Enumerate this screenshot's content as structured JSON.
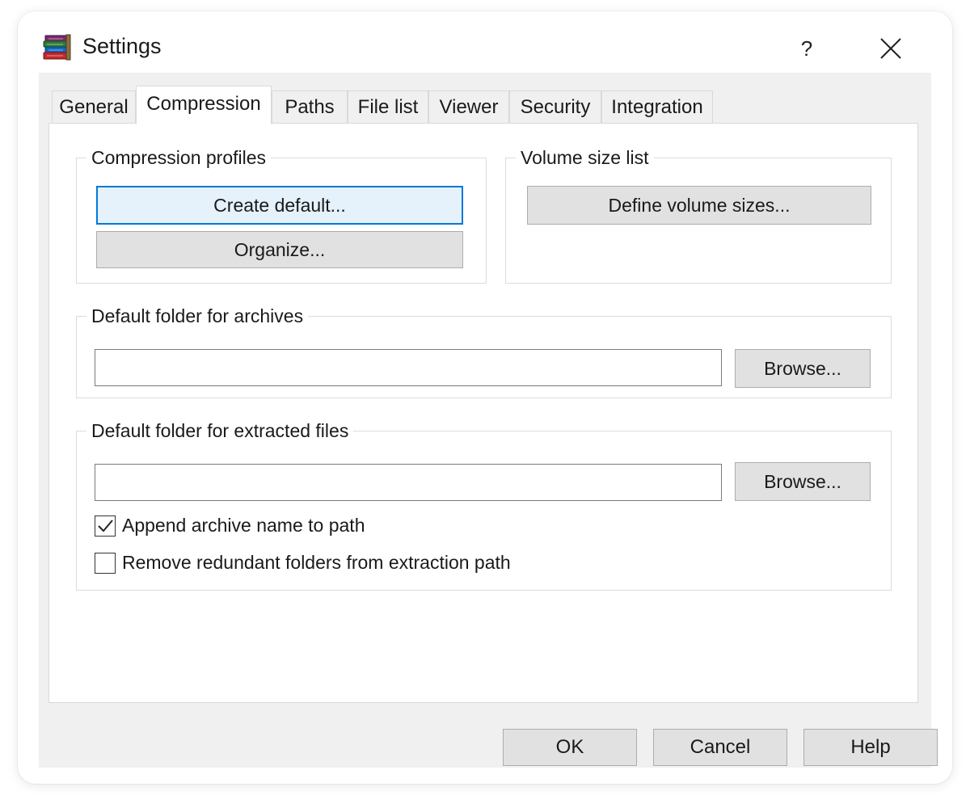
{
  "window": {
    "title": "Settings",
    "help_label": "?",
    "icons": {
      "app": "winrar-books-icon",
      "help": "question-mark-icon",
      "close": "close-icon"
    }
  },
  "tabs": [
    {
      "label": "General",
      "active": false
    },
    {
      "label": "Compression",
      "active": true
    },
    {
      "label": "Paths",
      "active": false
    },
    {
      "label": "File list",
      "active": false
    },
    {
      "label": "Viewer",
      "active": false
    },
    {
      "label": "Security",
      "active": false
    },
    {
      "label": "Integration",
      "active": false
    }
  ],
  "compression_profiles": {
    "label": "Compression profiles",
    "create_default": "Create default...",
    "organize": "Organize..."
  },
  "volume_size_list": {
    "label": "Volume size list",
    "define": "Define volume sizes..."
  },
  "archives_folder": {
    "label": "Default folder for archives",
    "value": "",
    "browse": "Browse..."
  },
  "extracted_folder": {
    "label": "Default folder for extracted files",
    "value": "",
    "browse": "Browse...",
    "append_archive_name": {
      "label": "Append archive name to path",
      "checked": true
    },
    "remove_redundant": {
      "label": "Remove redundant folders from extraction path",
      "checked": false
    }
  },
  "footer": {
    "ok": "OK",
    "cancel": "Cancel",
    "help": "Help"
  },
  "colors": {
    "focus_border": "#0078d7",
    "focus_fill": "#e5f1fb",
    "button_face": "#e1e1e1",
    "dialog_bg": "#f0f0f0"
  }
}
